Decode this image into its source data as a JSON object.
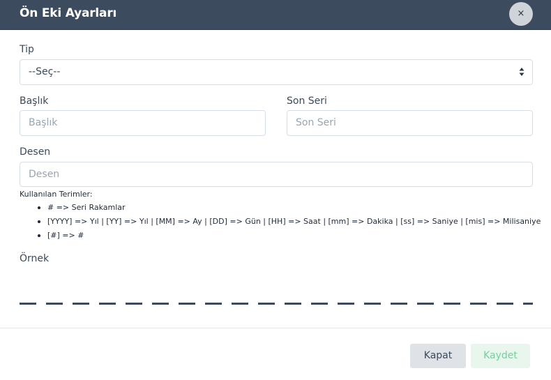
{
  "dialog": {
    "title": "Ön Eki Ayarları",
    "close_label": "×"
  },
  "form": {
    "tip": {
      "label": "Tip",
      "value": "--Seç--"
    },
    "baslik": {
      "label": "Başlık",
      "placeholder": "Başlık"
    },
    "son_seri": {
      "label": "Son Seri",
      "placeholder": "Son Seri"
    },
    "desen": {
      "label": "Desen",
      "placeholder": "Desen"
    },
    "terms": {
      "title": "Kullanılan Terimler:",
      "items": [
        "# => Seri Rakamlar",
        "[YYYY] => Yıl | [YY] => Yıl | [MM] => Ay | [DD] => Gün | [HH] => Saat | [mm] => Dakika | [ss] => Saniye | [mis] => Milisaniye",
        "[#] => #"
      ]
    },
    "ornek": {
      "label": "Örnek"
    }
  },
  "footer": {
    "close_label": "Kapat",
    "save_label": "Kaydet"
  }
}
